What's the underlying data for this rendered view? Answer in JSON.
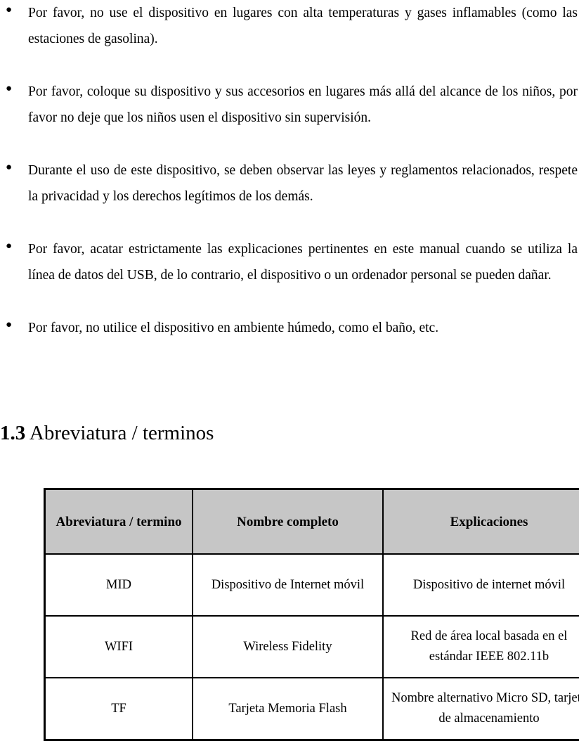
{
  "document": {
    "bullets": [
      {
        "marker": "●",
        "text": "Por favor, no use el dispositivo en lugares con alta temperaturas y gases inflamables (como las estaciones de gasolina)."
      },
      {
        "marker": "●",
        "text": "Por favor, coloque su dispositivo y sus accesorios en lugares más allá del alcance de los niños, por favor no deje que los niños usen el dispositivo sin supervisión."
      },
      {
        "marker": "●",
        "text": "Durante el uso de este dispositivo, se deben observar las leyes y reglamentos relacionados, respete la privacidad y los derechos legítimos de los demás."
      },
      {
        "marker": "●",
        "text": "Por favor, acatar estrictamente las explicaciones pertinentes en este manual cuando se utiliza la línea de datos del USB, de lo contrario, el dispositivo o un ordenador personal se pueden dañar."
      },
      {
        "marker": "●",
        "text": "Por favor, no utilice el dispositivo en ambiente húmedo, como el baño, etc."
      }
    ],
    "heading": {
      "number": "1.3",
      "title": "Abreviatura / terminos"
    },
    "table": {
      "headers": [
        "Abreviatura / termino",
        "Nombre completo",
        "Explicaciones"
      ],
      "rows": [
        {
          "abbreviation": "MID",
          "full_name": "Dispositivo de Internet móvil",
          "explanation": "Dispositivo de internet móvil"
        },
        {
          "abbreviation": "WIFI",
          "full_name": "Wireless Fidelity",
          "explanation": "Red de área local basada en el estándar IEEE 802.11b"
        },
        {
          "abbreviation": "TF",
          "full_name": "Tarjeta Memoria Flash",
          "explanation": "Nombre alternativo Micro SD, tarjeta de almacenamiento"
        }
      ],
      "header_background": "#c6c6c6"
    }
  }
}
